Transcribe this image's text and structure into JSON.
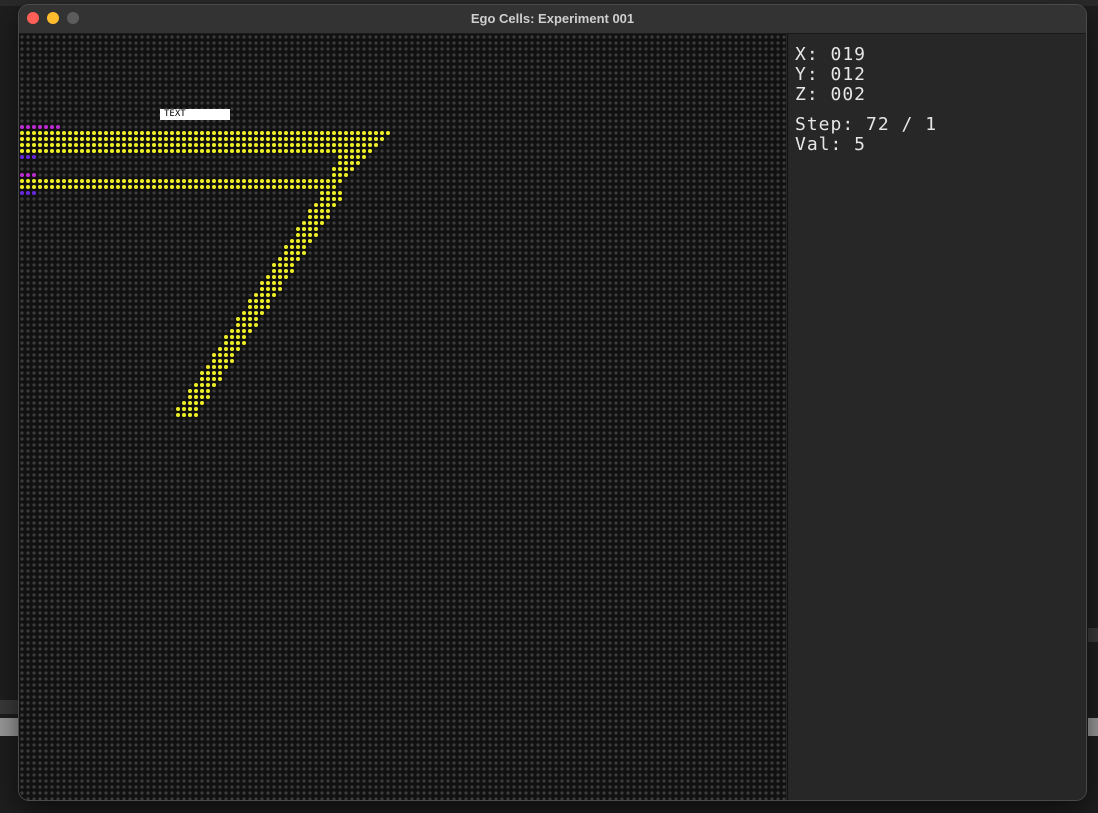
{
  "window": {
    "title": "Ego Cells: Experiment 001"
  },
  "grid": {
    "overlay_label": "TEXT",
    "colors": {
      "background": "#111111",
      "empty_cell": "#3b3b3b",
      "active": "#f0f028",
      "magenta": "#c02ad6",
      "violet": "#6a28e0"
    }
  },
  "panel": {
    "x": "X: 019",
    "y": "Y: 012",
    "z": "Z: 002",
    "step": "Step: 72 / 1",
    "val": "Val: 5"
  }
}
